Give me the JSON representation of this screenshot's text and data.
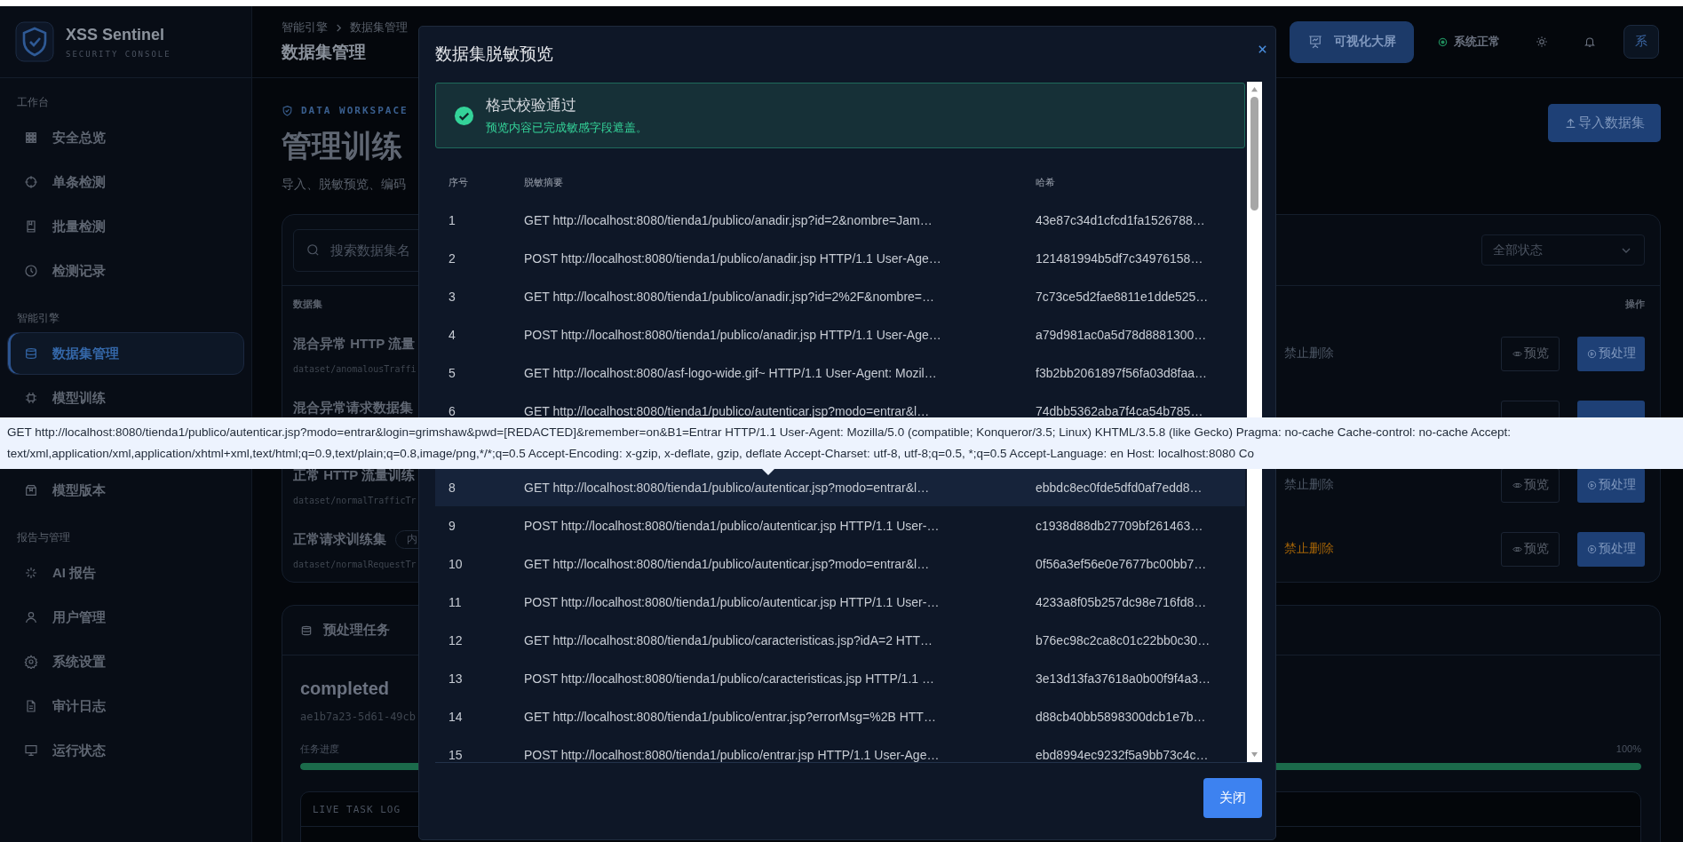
{
  "sidebar": {
    "brand": {
      "name": "XSS Sentinel",
      "tagline": "SECURITY CONSOLE"
    },
    "sections": [
      {
        "title": "工作台",
        "items": [
          {
            "label": "安全总览",
            "selected": false
          },
          {
            "label": "单条检测",
            "selected": false
          },
          {
            "label": "批量检测",
            "selected": false
          },
          {
            "label": "检测记录",
            "selected": false
          }
        ]
      },
      {
        "title": "智能引擎",
        "items": [
          {
            "label": "数据集管理",
            "selected": true
          },
          {
            "label": "模型训练",
            "selected": false
          },
          {
            "label": "模型版本",
            "selected": false
          }
        ]
      },
      {
        "title": "报告与管理",
        "items": [
          {
            "label": "AI 报告",
            "selected": false
          },
          {
            "label": "用户管理",
            "selected": false
          },
          {
            "label": "系统设置",
            "selected": false
          },
          {
            "label": "审计日志",
            "selected": false
          },
          {
            "label": "运行状态",
            "selected": false
          }
        ]
      }
    ]
  },
  "header": {
    "breadcrumb": [
      "智能引擎",
      "数据集管理"
    ],
    "title": "数据集管理",
    "dashboard_button": "可视化大屏",
    "status": "系统正常",
    "avatar": "系"
  },
  "hero": {
    "eyebrow": "DATA WORKSPACE",
    "title": "管理训练",
    "subtitle": "导入、脱敏预览、编码",
    "import_button": "导入数据集"
  },
  "datasets": {
    "search": {
      "placeholder": "搜索数据集名"
    },
    "status_filter": "全部状态",
    "columns": [
      "数据集",
      "操作"
    ],
    "rows": [
      {
        "name": "混合异常 HTTP 流量",
        "path": "dataset/anomalousTraffi",
        "note": "禁止删除",
        "color": "#4b5563",
        "preview": "预览",
        "process": "预处理"
      },
      {
        "name": "混合异常请求数据集"
      },
      {
        "name": "正常 HTTP 流量训练",
        "path": "dataset/normalTrafficTr",
        "note": "禁止删除",
        "color": "#4b5563",
        "preview": "预览",
        "process": "预处理"
      },
      {
        "name": "正常请求训练集",
        "badge": "内",
        "path": "dataset/normalRequestTr",
        "note": "禁止删除",
        "color": "#a16207",
        "preview": "预览",
        "process": "预处理"
      }
    ]
  },
  "task": {
    "title": "预处理任务",
    "status": "completed",
    "id": "ae1b7a23-5d61-49cb",
    "progress_label": "任务进度",
    "reading": "100%",
    "level": 1,
    "log_title": "LIVE TASK LOG"
  },
  "modal": {
    "title": "数据集脱敏预览",
    "alert": {
      "title": "格式校验通过",
      "message": "预览内容已完成敏感字段遮盖。"
    },
    "columns": [
      "序号",
      "脱敏摘要",
      "哈希"
    ],
    "rows": [
      {
        "no": "1",
        "summary": "GET http://localhost:8080/tienda1/publico/anadir.jsp?id=2&nombre=Jam…",
        "hash": "43e87c34d1cfcd1fa1526788…",
        "highlighted": false
      },
      {
        "no": "2",
        "summary": "POST http://localhost:8080/tienda1/publico/anadir.jsp HTTP/1.1 User-Age…",
        "hash": "121481994b5df7c34976158…",
        "highlighted": false
      },
      {
        "no": "3",
        "summary": "GET http://localhost:8080/tienda1/publico/anadir.jsp?id=2%2F&nombre=…",
        "hash": "7c73ce5d2fae8811e1dde525…",
        "highlighted": false
      },
      {
        "no": "4",
        "summary": "POST http://localhost:8080/tienda1/publico/anadir.jsp HTTP/1.1 User-Age…",
        "hash": "a79d981ac0a5d78d8881300…",
        "highlighted": false
      },
      {
        "no": "5",
        "summary": "GET http://localhost:8080/asf-logo-wide.gif~ HTTP/1.1 User-Agent: Mozil…",
        "hash": "f3b2bb2061897f56fa03d8faa…",
        "highlighted": false
      },
      {
        "no": "6",
        "summary": "GET http://localhost:8080/tienda1/publico/autenticar.jsp?modo=entrar&l…",
        "hash": "74dbb5362aba7f4ca54b785…",
        "highlighted": false
      },
      {
        "no": "8",
        "summary": "GET http://localhost:8080/tienda1/publico/autenticar.jsp?modo=entrar&l…",
        "hash": "ebbdc8ec0fde5dfd0af7edd8…",
        "highlighted": true
      },
      {
        "no": "9",
        "summary": "POST http://localhost:8080/tienda1/publico/autenticar.jsp HTTP/1.1 User-…",
        "hash": "c1938d88db27709bf261463…",
        "highlighted": false
      },
      {
        "no": "10",
        "summary": "GET http://localhost:8080/tienda1/publico/autenticar.jsp?modo=entrar&l…",
        "hash": "0f56a3ef56e0e7677bc00bb7…",
        "highlighted": false
      },
      {
        "no": "11",
        "summary": "POST http://localhost:8080/tienda1/publico/autenticar.jsp HTTP/1.1 User-…",
        "hash": "4233a8f05b257dc98e716fd8…",
        "highlighted": false
      },
      {
        "no": "12",
        "summary": "GET http://localhost:8080/tienda1/publico/caracteristicas.jsp?idA=2 HTT…",
        "hash": "b76ec98c2ca8c01c22bb0c30…",
        "highlighted": false
      },
      {
        "no": "13",
        "summary": "POST http://localhost:8080/tienda1/publico/caracteristicas.jsp HTTP/1.1 …",
        "hash": "3e13d13fa37618a0b00f9f4a3…",
        "highlighted": false
      },
      {
        "no": "14",
        "summary": "GET http://localhost:8080/tienda1/publico/entrar.jsp?errorMsg=%2B HTT…",
        "hash": "d88cb40bb5898300dcb1e7b…",
        "highlighted": false
      },
      {
        "no": "15",
        "summary": "POST http://localhost:8080/tienda1/publico/entrar.jsp HTTP/1.1 User-Age…",
        "hash": "ebd8994ec9232f5a9bb73c4c…",
        "highlighted": false
      }
    ],
    "close_button": "关闭"
  },
  "tooltip": {
    "text": "GET http://localhost:8080/tienda1/publico/autenticar.jsp?modo=entrar&login=grimshaw&pwd=[REDACTED]&remember=on&B1=Entrar HTTP/1.1 User-Agent: Mozilla/5.0 (compatible; Konqueror/3.5; Linux) KHTML/3.5.8 (like Gecko) Pragma: no-cache Cache-control: no-cache Accept: text/xml,application/xml,application/xhtml+xml,text/html;q=0.9,text/plain;q=0.8,image/png,*/*;q=0.5 Accept-Encoding: x-gzip, x-deflate, gzip, deflate Accept-Charset: utf-8, utf-8;q=0.5, *;q=0.5 Accept-Language: en Host: localhost:8080 Co"
  }
}
